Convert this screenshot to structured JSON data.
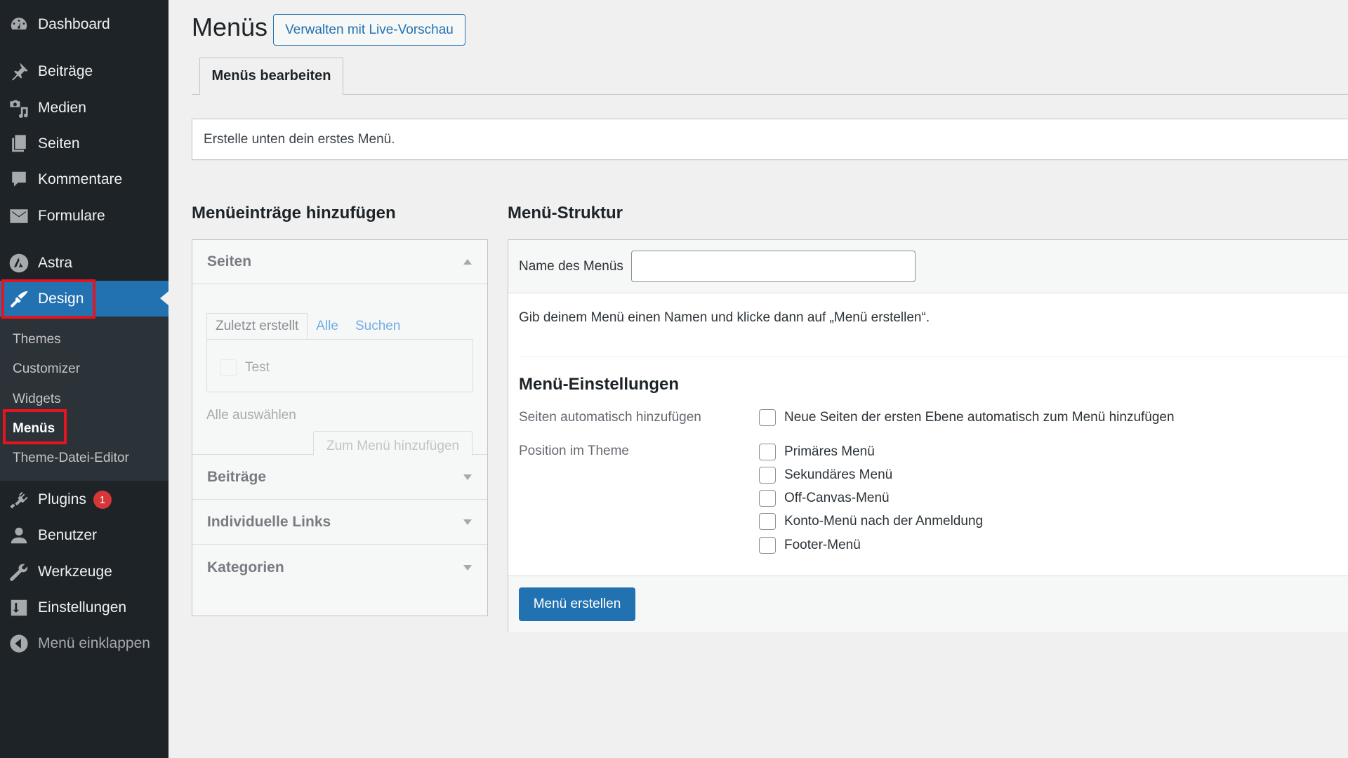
{
  "sidebar": {
    "items": [
      {
        "key": "dashboard",
        "label": "Dashboard",
        "icon": "dashboard-icon"
      },
      {
        "key": "beitraege",
        "label": "Beiträge",
        "icon": "pin-icon"
      },
      {
        "key": "medien",
        "label": "Medien",
        "icon": "media-icon"
      },
      {
        "key": "seiten",
        "label": "Seiten",
        "icon": "pages-icon"
      },
      {
        "key": "kommentare",
        "label": "Kommentare",
        "icon": "comment-icon"
      },
      {
        "key": "formulare",
        "label": "Formulare",
        "icon": "mail-icon"
      },
      {
        "key": "astra",
        "label": "Astra",
        "icon": "astra-icon"
      },
      {
        "key": "design",
        "label": "Design",
        "icon": "paintbrush-icon",
        "active": true
      },
      {
        "key": "plugins",
        "label": "Plugins",
        "icon": "plugin-icon",
        "badge": "1"
      },
      {
        "key": "benutzer",
        "label": "Benutzer",
        "icon": "user-icon"
      },
      {
        "key": "werkzeuge",
        "label": "Werkzeuge",
        "icon": "wrench-icon"
      },
      {
        "key": "einstellungen",
        "label": "Einstellungen",
        "icon": "settings-icon"
      }
    ],
    "submenu": [
      {
        "label": "Themes"
      },
      {
        "label": "Customizer"
      },
      {
        "label": "Widgets"
      },
      {
        "label": "Menüs",
        "current": true
      },
      {
        "label": "Theme-Datei-Editor"
      }
    ],
    "collapse_label": "Menü einklappen"
  },
  "header": {
    "title": "Menüs",
    "live_preview_button": "Verwalten mit Live-Vorschau"
  },
  "tabs": [
    {
      "label": "Menüs bearbeiten",
      "active": true
    }
  ],
  "notice": "Erstelle unten dein erstes Menü.",
  "add_items": {
    "title": "Menüeinträge hinzufügen",
    "sections": [
      {
        "label": "Seiten",
        "expanded": true
      },
      {
        "label": "Beiträge",
        "expanded": false
      },
      {
        "label": "Individuelle Links",
        "expanded": false
      },
      {
        "label": "Kategorien",
        "expanded": false
      }
    ],
    "pages_tabs": [
      {
        "label": "Zuletzt erstellt",
        "active": true
      },
      {
        "label": "Alle"
      },
      {
        "label": "Suchen"
      }
    ],
    "pages_items": [
      {
        "label": "Test",
        "checked": false
      }
    ],
    "select_all": "Alle auswählen",
    "add_button": "Zum Menü hinzufügen"
  },
  "structure": {
    "title": "Menü-Struktur",
    "name_label": "Name des Menüs",
    "name_value": "",
    "hint": "Gib deinem Menü einen Namen und klicke dann auf „Menü erstellen“.",
    "settings_title": "Menü-Einstellungen",
    "auto_add_label": "Seiten automatisch hinzufügen",
    "auto_add_option": "Neue Seiten der ersten Ebene automatisch zum Menü hinzufügen",
    "position_label": "Position im Theme",
    "positions": [
      {
        "label": "Primäres Menü",
        "checked": false
      },
      {
        "label": "Sekundäres Menü",
        "checked": false
      },
      {
        "label": "Off-Canvas-Menü",
        "checked": false
      },
      {
        "label": "Konto-Menü nach der Anmeldung",
        "checked": false
      },
      {
        "label": "Footer-Menü",
        "checked": false
      }
    ],
    "create_button": "Menü erstellen"
  },
  "colors": {
    "sidebar_bg": "#1d2327",
    "submenu_bg": "#2c3338",
    "accent": "#2271b1",
    "badge": "#d63638",
    "highlight_annotation": "#e5141f"
  }
}
